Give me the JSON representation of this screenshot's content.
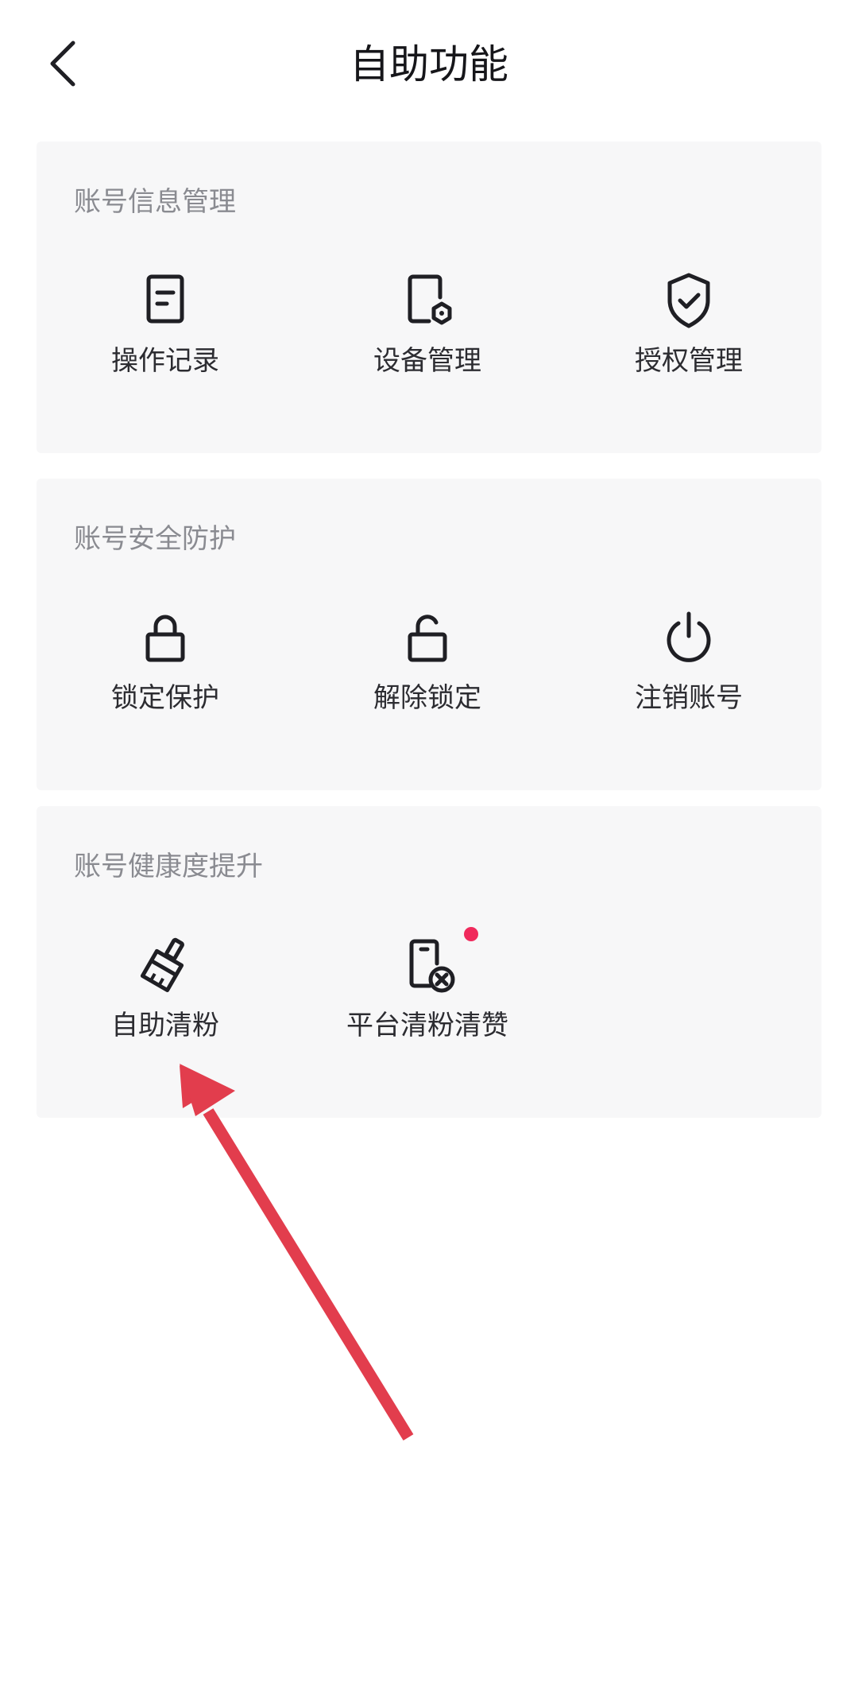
{
  "header": {
    "title": "自助功能",
    "back_icon": "chevron-left-icon"
  },
  "sections": [
    {
      "title": "账号信息管理",
      "items": [
        {
          "label": "操作记录",
          "icon": "document-icon"
        },
        {
          "label": "设备管理",
          "icon": "device-settings-icon"
        },
        {
          "label": "授权管理",
          "icon": "shield-check-icon"
        }
      ]
    },
    {
      "title": "账号安全防护",
      "items": [
        {
          "label": "锁定保护",
          "icon": "lock-icon"
        },
        {
          "label": "解除锁定",
          "icon": "unlock-icon"
        },
        {
          "label": "注销账号",
          "icon": "power-icon"
        }
      ]
    },
    {
      "title": "账号健康度提升",
      "items": [
        {
          "label": "自助清粉",
          "icon": "brush-icon"
        },
        {
          "label": "平台清粉清赞",
          "icon": "phone-remove-icon",
          "badge": "red-dot"
        }
      ]
    }
  ],
  "colors": {
    "background": "#ffffff",
    "card": "#f7f7f8",
    "section_title": "#8a8b91",
    "text": "#2c2c31",
    "badge": "#f02a5c",
    "annotation_arrow": "#e23d4d"
  }
}
